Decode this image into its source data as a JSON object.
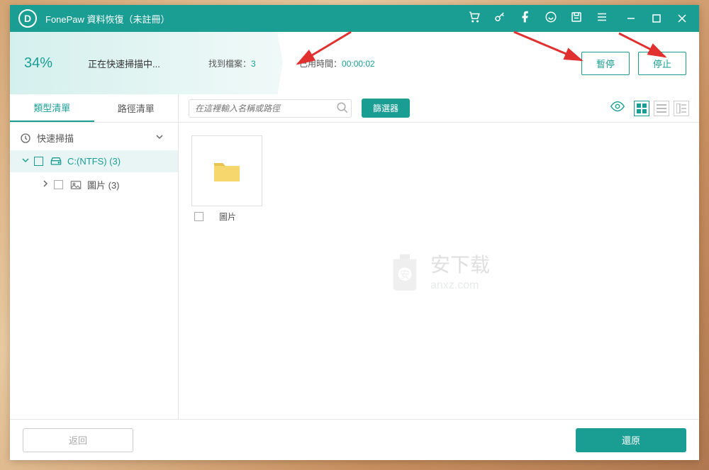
{
  "titlebar": {
    "app_title": "FonePaw 資料恢復（未註冊）"
  },
  "progress": {
    "percent": "34%",
    "scanning_label": "正在快速掃描中...",
    "file_count_label": "找到檔案：",
    "file_count_value": "3",
    "elapsed_label": "已用時間：",
    "elapsed_value": "00:00:02",
    "pause_label": "暫停",
    "stop_label": "停止"
  },
  "sidebar": {
    "tabs": [
      {
        "label": "類型清單"
      },
      {
        "label": "路徑清單"
      }
    ],
    "tree": {
      "quick_scan": "快速掃描",
      "drive": "C:(NTFS) (3)",
      "images": "圖片 (3)"
    }
  },
  "toolbar": {
    "search_placeholder": "在這裡輸入名稱或路徑",
    "filter_label": "篩選器"
  },
  "grid": {
    "folder_label": "圖片"
  },
  "watermark": {
    "main": "安下载",
    "sub": "anxz.com"
  },
  "footer": {
    "back_label": "返回",
    "restore_label": "還原"
  }
}
